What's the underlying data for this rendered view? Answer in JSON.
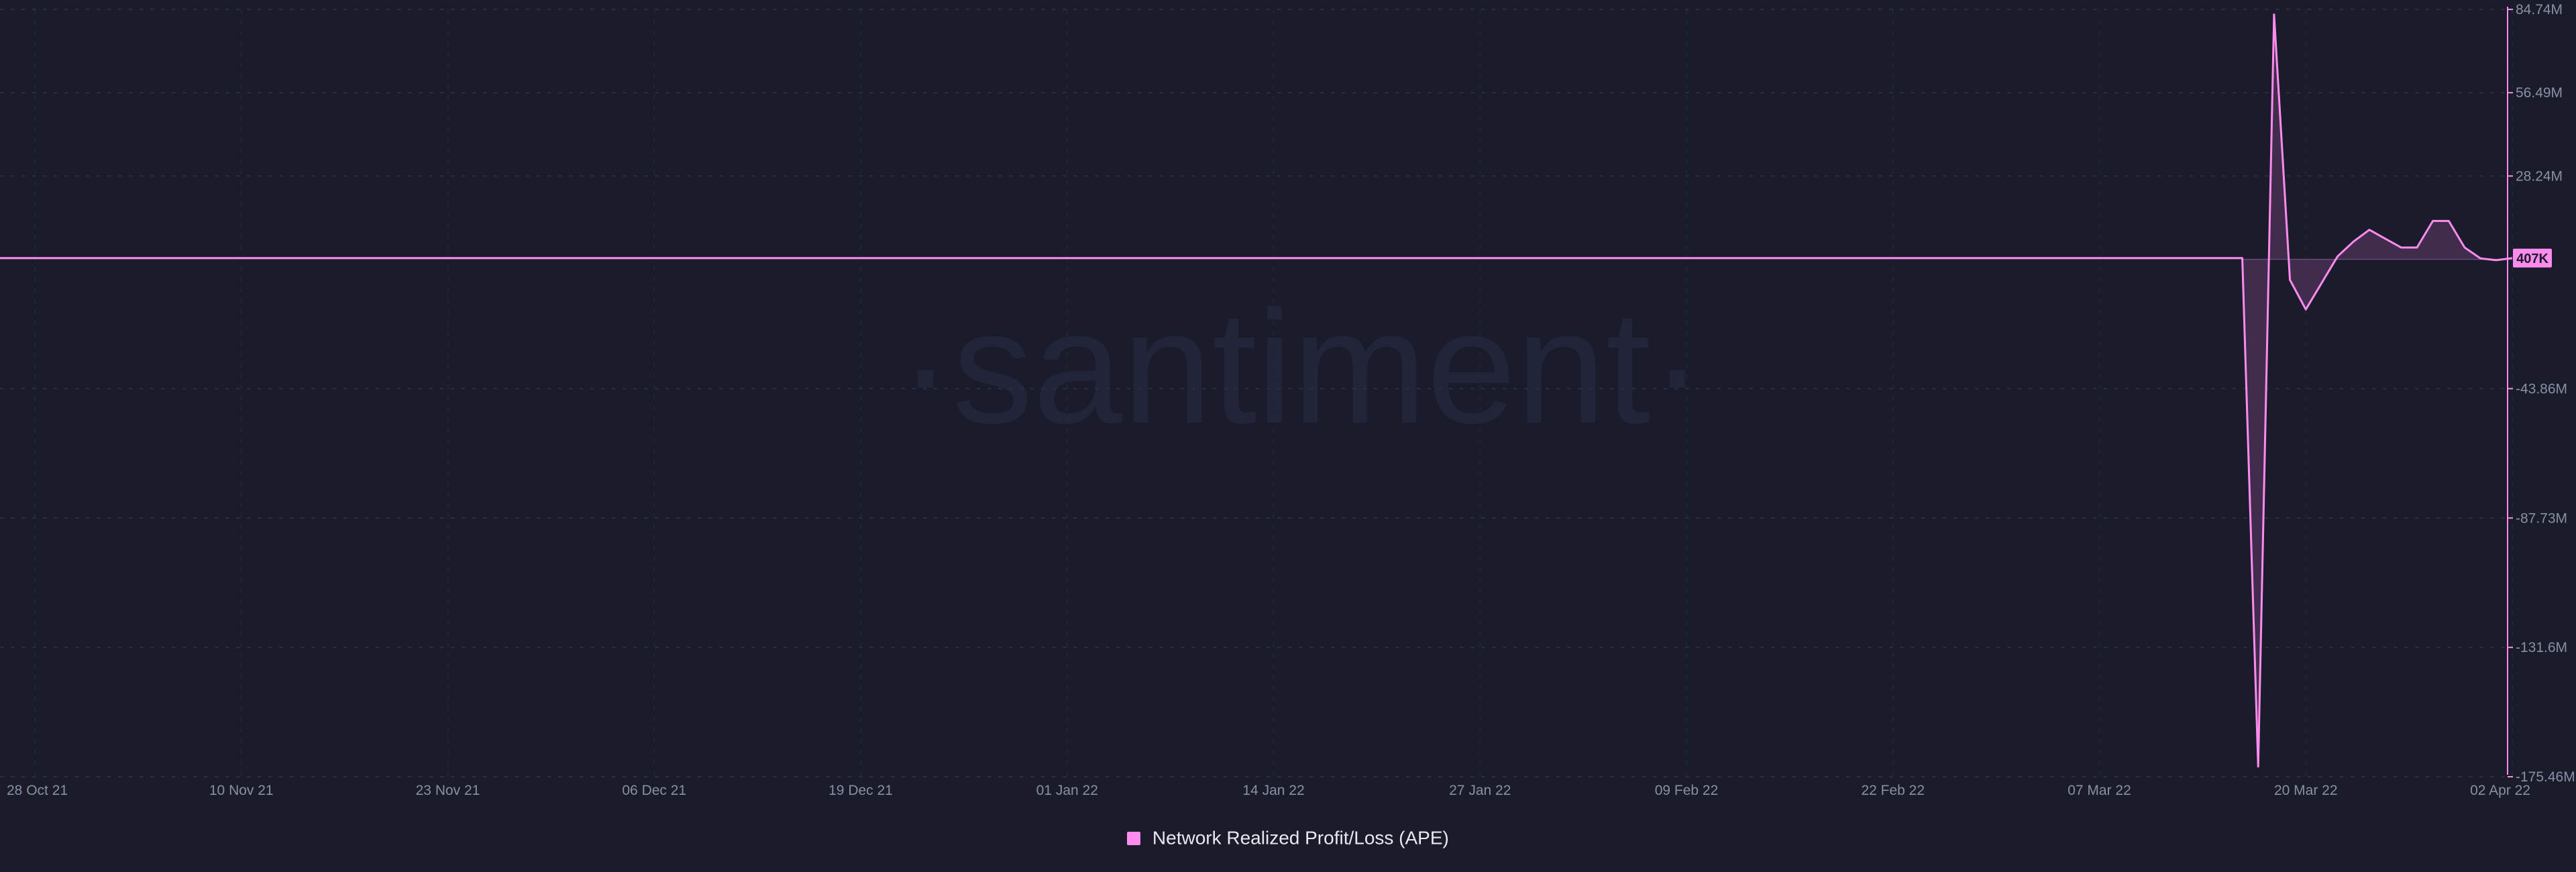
{
  "watermark": "·santiment·",
  "legend": {
    "label": "Network Realized Profit/Loss (APE)",
    "color": "#ff8bee"
  },
  "colors": {
    "background": "#1a1c2b",
    "line": "#ff8bee",
    "area": "#4a2f55",
    "grid": "#2a2e42",
    "text": "#8a8fa3"
  },
  "chart_data": {
    "type": "area",
    "title": "",
    "xlabel": "",
    "ylabel": "",
    "x_tick_labels": [
      "28 Oct 21",
      "10 Nov 21",
      "23 Nov 21",
      "06 Dec 21",
      "19 Dec 21",
      "01 Jan 22",
      "14 Jan 22",
      "27 Jan 22",
      "09 Feb 22",
      "22 Feb 22",
      "07 Mar 22",
      "20 Mar 22",
      "02 Apr 22"
    ],
    "y_tick_labels": [
      "84.74M",
      "56.49M",
      "28.24M",
      "-43.86M",
      "-87.73M",
      "-131.6M",
      "-175.46M"
    ],
    "y_tick_values": [
      84.74,
      56.49,
      28.24,
      -43.86,
      -87.73,
      -131.6,
      -175.46
    ],
    "ylim": [
      -175.46,
      84.74
    ],
    "y_unit": "M",
    "xlim": [
      "2021-10-28",
      "2022-04-02"
    ],
    "last_value_label": "407K",
    "grid": true,
    "series": [
      {
        "name": "Network Realized Profit/Loss (APE)",
        "x": [
          "2021-10-28",
          "2022-03-16",
          "2022-03-17",
          "2022-03-18",
          "2022-03-19",
          "2022-03-20",
          "2022-03-21",
          "2022-03-22",
          "2022-03-23",
          "2022-03-24",
          "2022-03-25",
          "2022-03-26",
          "2022-03-27",
          "2022-03-28",
          "2022-03-29",
          "2022-03-30",
          "2022-03-31",
          "2022-04-01",
          "2022-04-02"
        ],
        "y": [
          0.4,
          0.4,
          -172,
          83,
          -7,
          -17,
          -8,
          1,
          6,
          10,
          7,
          4,
          4,
          13,
          13,
          4,
          0.3,
          -0.3,
          0.407
        ]
      }
    ]
  }
}
